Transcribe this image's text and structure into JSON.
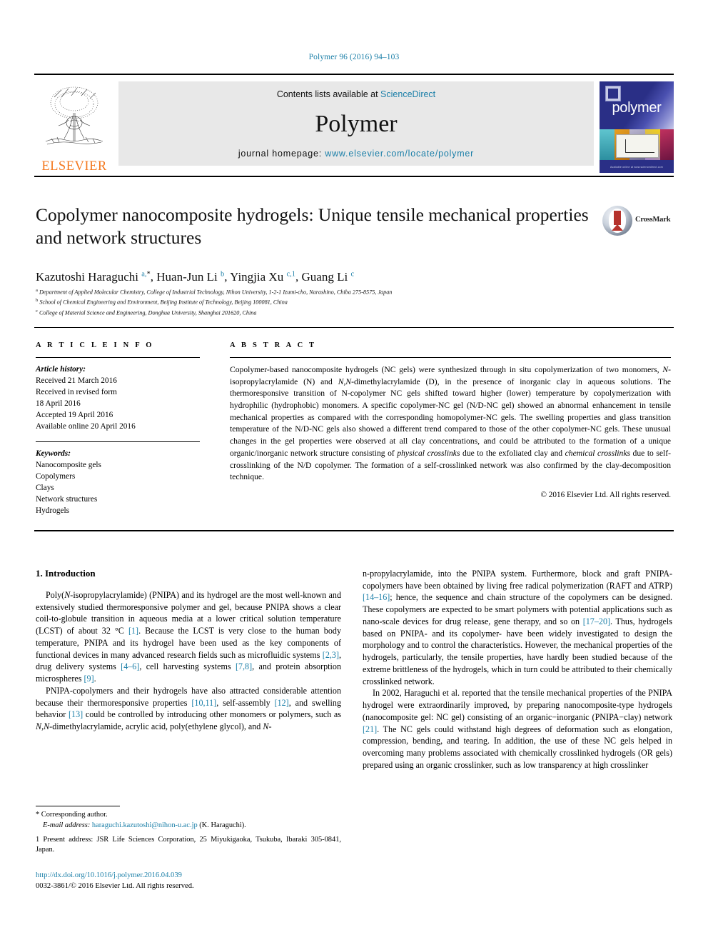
{
  "runhead": "Polymer 96 (2016) 94–103",
  "masthead": {
    "publisher": "ELSEVIER",
    "contents_prefix": "Contents lists available at ",
    "contents_link": "ScienceDirect",
    "journal_name": "Polymer",
    "homepage_prefix": "journal homepage: ",
    "homepage_url": "www.elsevier.com/locate/polymer",
    "cover_title": "polymer",
    "cover_footer": "Available online at www.sciencedirect.com"
  },
  "article": {
    "title": "Copolymer nanocomposite hydrogels: Unique tensile mechanical properties and network structures",
    "crossmark_label": "CrossMark",
    "authors_html": "Kazutoshi Haraguchi <sup>a,</sup><sup class=\"star\">*</sup>, Huan-Jun Li <sup>b</sup>, Yingjia Xu <sup>c,1</sup>, Guang Li <sup>c</sup>",
    "affiliations": [
      {
        "mark": "a",
        "text": "Department of Applied Molecular Chemistry, College of Industrial Technology, Nihon University, 1-2-1 Izumi-cho, Narashino, Chiba 275-8575, Japan"
      },
      {
        "mark": "b",
        "text": "School of Chemical Engineering and Environment, Beijing Institute of Technology, Beijing 100081, China"
      },
      {
        "mark": "c",
        "text": "College of Material Science and Engineering, Donghua University, Shanghai 201620, China"
      }
    ]
  },
  "article_info": {
    "heading": "A R T I C L E   I N F O",
    "history_label": "Article history:",
    "history": [
      "Received 21 March 2016",
      "Received in revised form",
      "18 April 2016",
      "Accepted 19 April 2016",
      "Available online 20 April 2016"
    ],
    "keywords_label": "Keywords:",
    "keywords": [
      "Nanocomposite gels",
      "Copolymers",
      "Clays",
      "Network structures",
      "Hydrogels"
    ]
  },
  "abstract": {
    "heading": "A B S T R A C T",
    "text_html": "Copolymer-based nanocomposite hydrogels (NC gels) were synthesized through in situ copolymerization of two monomers, <i>N</i>-isopropylacrylamide (N) and <i>N,N</i>-dimethylacrylamide (D), in the presence of inorganic clay in aqueous solutions. The thermoresponsive transition of N-copolymer NC gels shifted toward higher (lower) temperature by copolymerization with hydrophilic (hydrophobic) monomers. A specific copolymer-NC gel (N/D-NC gel) showed an abnormal enhancement in tensile mechanical properties as compared with the corresponding homopolymer-NC gels. The swelling properties and glass transition temperature of the N/D-NC gels also showed a different trend compared to those of the other copolymer-NC gels. These unusual changes in the gel properties were observed at all clay concentrations, and could be attributed to the formation of a unique organic/inorganic network structure consisting of <i>physical crosslinks</i> due to the exfoliated clay and <i>chemical crosslinks</i> due to self-crosslinking of the N/D copolymer. The formation of a self-crosslinked network was also confirmed by the clay-decomposition technique.",
    "copyright": "© 2016 Elsevier Ltd. All rights reserved."
  },
  "introduction": {
    "heading": "1. Introduction",
    "left_paragraphs_html": [
      "Poly(<i>N</i>-isopropylacrylamide) (PNIPA) and its hydrogel are the most well-known and extensively studied thermoresponsive polymer and gel, because PNIPA shows a clear coil-to-globule transition in aqueous media at a lower critical solution temperature (LCST) of about 32 °C <span class=\"ref\">[1]</span>. Because the LCST is very close to the human body temperature, PNIPA and its hydrogel have been used as the key components of functional devices in many advanced research fields such as microfluidic systems <span class=\"ref\">[2,3]</span>, drug delivery systems <span class=\"ref\">[4–6]</span>, cell harvesting systems <span class=\"ref\">[7,8]</span>, and protein absorption microspheres <span class=\"ref\">[9]</span>.",
      "PNIPA-copolymers and their hydrogels have also attracted considerable attention because their thermoresponsive properties <span class=\"ref\">[10,11]</span>, self-assembly <span class=\"ref\">[12]</span>, and swelling behavior <span class=\"ref\">[13]</span> could be controlled by introducing other monomers or polymers, such as <i>N,N</i>-dimethylacrylamide, acrylic acid, poly(ethylene glycol), and <i>N</i>-"
    ],
    "right_paragraphs_html": [
      "n-propylacrylamide, into the PNIPA system. Furthermore, block and graft PNIPA-copolymers have been obtained by living free radical polymerization (RAFT and ATRP) <span class=\"ref\">[14–16]</span>; hence, the sequence and chain structure of the copolymers can be designed. These copolymers are expected to be smart polymers with potential applications such as nano-scale devices for drug release, gene therapy, and so on <span class=\"ref\">[17–20]</span>. Thus, hydrogels based on PNIPA- and its copolymer- have been widely investigated to design the morphology and to control the characteristics. However, the mechanical properties of the hydrogels, particularly, the tensile properties, have hardly been studied because of the extreme brittleness of the hydrogels, which in turn could be attributed to their chemically crosslinked network.",
      "In 2002, Haraguchi et al. reported that the tensile mechanical properties of the PNIPA hydrogel were extraordinarily improved, by preparing nanocomposite-type hydrogels (nanocomposite gel: NC gel) consisting of an organic−inorganic (PNIPA−clay) network <span class=\"ref\">[21]</span>. The NC gels could withstand high degrees of deformation such as elongation, compression, bending, and tearing. In addition, the use of these NC gels helped in overcoming many problems associated with chemically crosslinked hydrogels (OR gels) prepared using an organic crosslinker, such as low transparency at high crosslinker"
    ]
  },
  "footnotes": {
    "corresponding_author": "* Corresponding author.",
    "email_label": "E-mail address:",
    "email": "haraguchi.kazutoshi@nihon-u.ac.jp",
    "email_suffix": "(K. Haraguchi).",
    "present_address": "1 Present address: JSR Life Sciences Corporation, 25 Miyukigaoka, Tsukuba, Ibaraki 305-0841, Japan."
  },
  "doi_block": {
    "doi": "http://dx.doi.org/10.1016/j.polymer.2016.04.039",
    "issn_line": "0032-3861/© 2016 Elsevier Ltd. All rights reserved."
  },
  "colors": {
    "link": "#1b7fa8",
    "elsevier_orange": "#f47920",
    "cover_blue": "#2a2f86"
  }
}
